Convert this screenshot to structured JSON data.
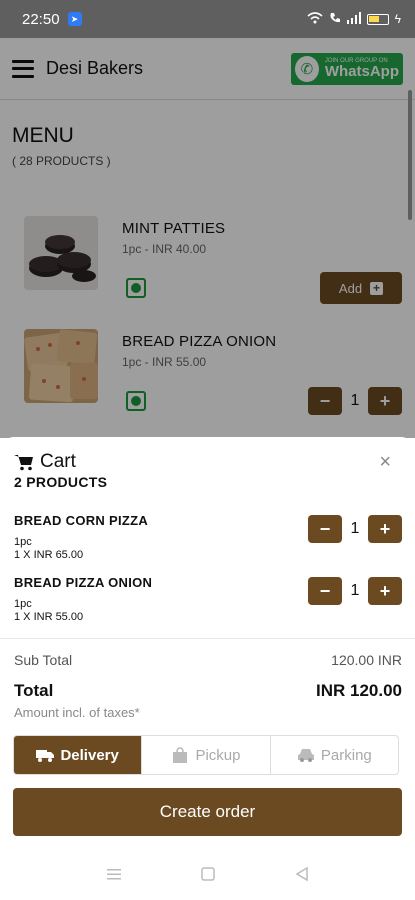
{
  "status_bar": {
    "time": "22:50"
  },
  "header": {
    "brand": "Desi Bakers",
    "whatsapp_small": "JOIN OUR GROUP ON",
    "whatsapp_big": "WhatsApp"
  },
  "menu": {
    "title": "MENU",
    "count": "( 28 PRODUCTS )",
    "products": [
      {
        "name": "MINT PATTIES",
        "price": "1pc - INR 40.00",
        "add_label": "Add"
      },
      {
        "name": "BREAD PIZZA ONION",
        "price": "1pc - INR 55.00",
        "qty": "1"
      }
    ]
  },
  "cart": {
    "title": "Cart",
    "close": "×",
    "count": "2 PRODUCTS",
    "items": [
      {
        "name": "BREAD CORN PIZZA",
        "unit": "1pc",
        "price": "1 X INR 65.00",
        "qty": "1"
      },
      {
        "name": "BREAD PIZZA ONION",
        "unit": "1pc",
        "price": "1 X INR 55.00",
        "qty": "1"
      }
    ],
    "sub_total_label": "Sub Total",
    "sub_total_value": "120.00 INR",
    "total_label": "Total",
    "total_value": "INR 120.00",
    "tax_note": "Amount incl. of taxes*",
    "modes": [
      {
        "label": "Delivery",
        "icon": "truck-icon",
        "active": true
      },
      {
        "label": "Pickup",
        "icon": "shopping-bag-icon",
        "active": false
      },
      {
        "label": "Parking",
        "icon": "car-icon",
        "active": false
      }
    ],
    "create_label": "Create order"
  },
  "colors": {
    "accent": "#6b4a22",
    "veg": "#1a9c3e",
    "whatsapp": "#25a84d"
  }
}
